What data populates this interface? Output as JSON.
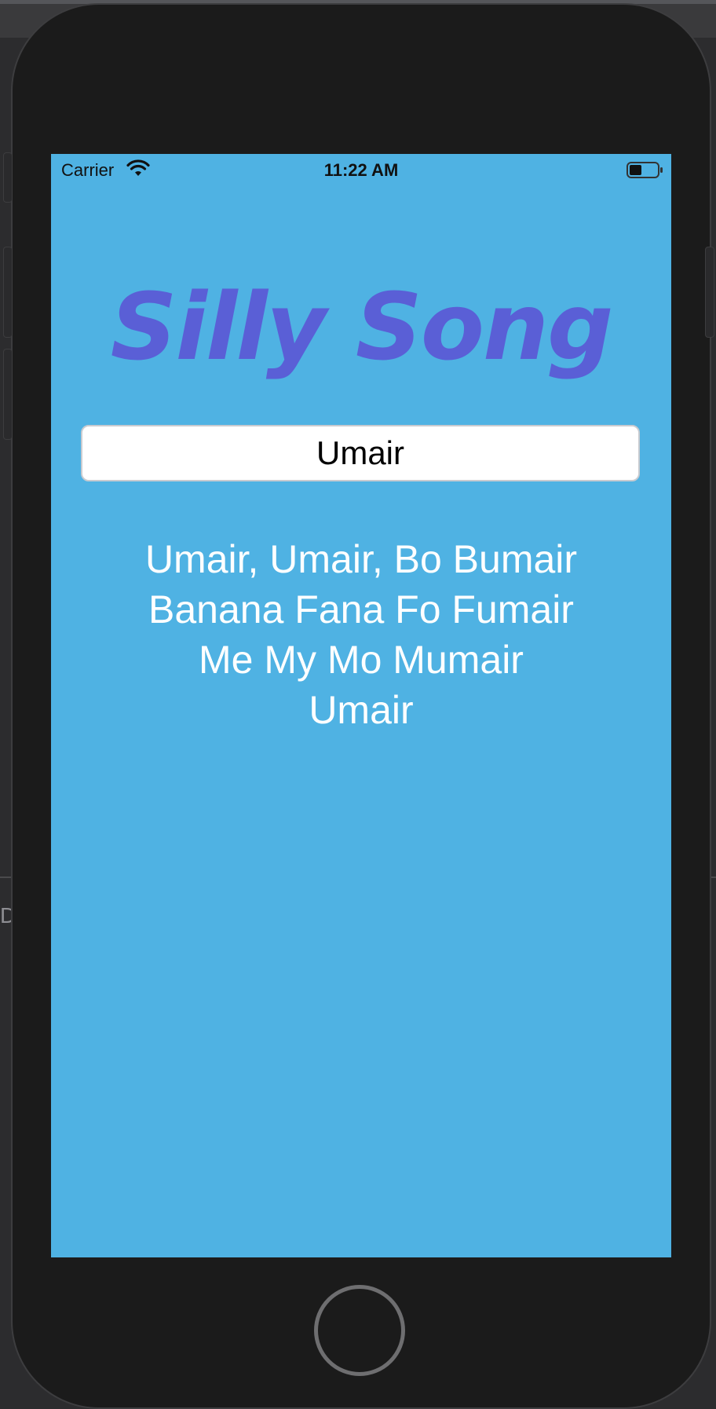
{
  "status_bar": {
    "carrier": "Carrier",
    "time": "11:22 AM",
    "icons": [
      "wifi-icon",
      "battery-icon"
    ]
  },
  "app": {
    "title": "Silly Song",
    "name_input": {
      "value": "Umair"
    },
    "lyrics": [
      "Umair, Umair, Bo Bumair",
      "Banana Fana Fo Fumair",
      "Me My Mo Mumair",
      "Umair"
    ]
  },
  "background": {
    "edge_text": "DE"
  },
  "colors": {
    "screen_background": "#4fb2e3",
    "title": "#5a5fd6",
    "lyrics": "#ffffff",
    "device_body": "#1b1b1b"
  }
}
